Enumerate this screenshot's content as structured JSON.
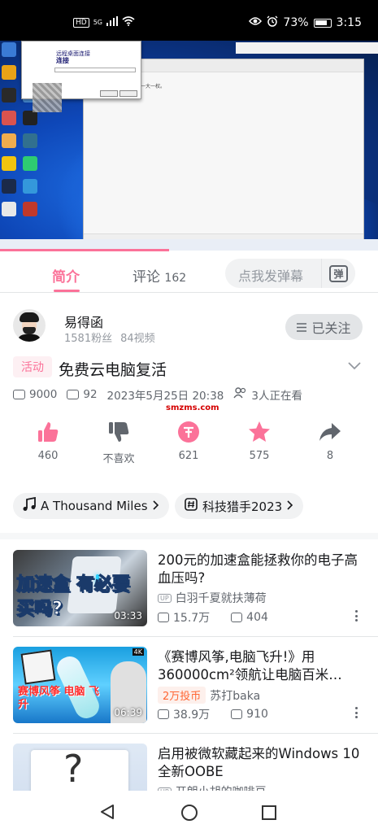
{
  "status": {
    "network_label": "HD",
    "signal_label": "5G",
    "battery_percent": "73%",
    "time": "3:15"
  },
  "video_tabs": {
    "intro": "简介",
    "comments_label": "评论",
    "comments_count": "162",
    "danmu_placeholder": "点我发弹幕",
    "danmu_button": "弹"
  },
  "uploader": {
    "name": "易得函",
    "followers": "1581粉丝",
    "videos": "84视频",
    "follow_state": "已关注"
  },
  "video": {
    "activity_badge": "活动",
    "title": "免费云电脑复活",
    "views": "9000",
    "danmaku": "92",
    "datetime": "2023年5月25日 20:38",
    "watching": "3人正在看",
    "watermark": "smzms.com"
  },
  "actions": {
    "like": "460",
    "dislike": "不喜欢",
    "coin": "621",
    "favorite": "575",
    "share": "8"
  },
  "tags": {
    "music": "A Thousand Miles",
    "topic": "科技猎手2023"
  },
  "related": [
    {
      "title": "200元的加速盒能拯救你的电子高血压吗?",
      "owner": "白羽千夏就扶薄荷",
      "views": "15.7万",
      "danmaku": "404",
      "duration": "03:33",
      "thumb_text": "加速盒 有必要买吗?"
    },
    {
      "title": "《赛博风筝,电脑飞升!》用360000cm²领航让电脑百米…",
      "coin_tag": "2万投币",
      "owner": "苏打baka",
      "views": "38.9万",
      "danmaku": "910",
      "duration": "06:39",
      "thumb_text": "赛博风筝 电脑 飞升",
      "thumb_badge": "4K"
    },
    {
      "title": "启用被微软藏起来的Windows 10全新OOBE",
      "owner": "开朗小胡的咖啡豆",
      "thumb_text": "?"
    }
  ],
  "screen_content": {
    "rdp_title": "远程桌面连接",
    "rdp_heading": "连接",
    "notepad_text": "一大一权。"
  },
  "colors": {
    "accent": "#fb7299",
    "text": "#18191c",
    "muted": "#61666d",
    "light": "#9499a0"
  }
}
